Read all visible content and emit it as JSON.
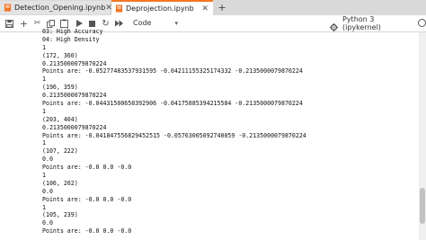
{
  "tabs": [
    {
      "label": "Detection_Opening.ipynb",
      "active": false
    },
    {
      "label": "Deprojection.ipynb",
      "active": true
    }
  ],
  "toolbar": {
    "cell_type": "Code",
    "kernel": "Python 3 (ipykernel)"
  },
  "output_lines": [
    "03: High Accuracy",
    "04: High Density",
    "1",
    "(172, 360)",
    "0.2135000079870224",
    "Points are: -0.05277483537931595 -0.04211155325174332 -0.2135000079870224",
    "1",
    "(196, 359)",
    "0.2135000079870224",
    "Points are: -0.04431500658392906 -0.04175885394215584 -0.2135000079870224",
    "1",
    "(203, 404)",
    "0.2135000079870224",
    "Points are: -0.041847556829452515 -0.05763005092740059 -0.2135000079870224",
    "1",
    "(107, 222)",
    "0.0",
    "Points are: -0.0 0.0 -0.0",
    "1",
    "(106, 202)",
    "0.0",
    "Points are: -0.0 0.0 -0.0",
    "1",
    "(105, 239)",
    "0.0",
    "Points are: -0.0 0.0 -0.0"
  ],
  "colors": {
    "accent": "#f37626",
    "tab_bg": "#d9d9d9"
  },
  "icons": [
    "notebook-icon",
    "close-icon",
    "plus-icon",
    "save-icon",
    "add-cell-icon",
    "cut-icon",
    "copy-icon",
    "paste-icon",
    "run-icon",
    "stop-icon",
    "restart-icon",
    "restart-run-icon",
    "chevron-down-icon",
    "gear-icon",
    "kernel-status-icon"
  ]
}
